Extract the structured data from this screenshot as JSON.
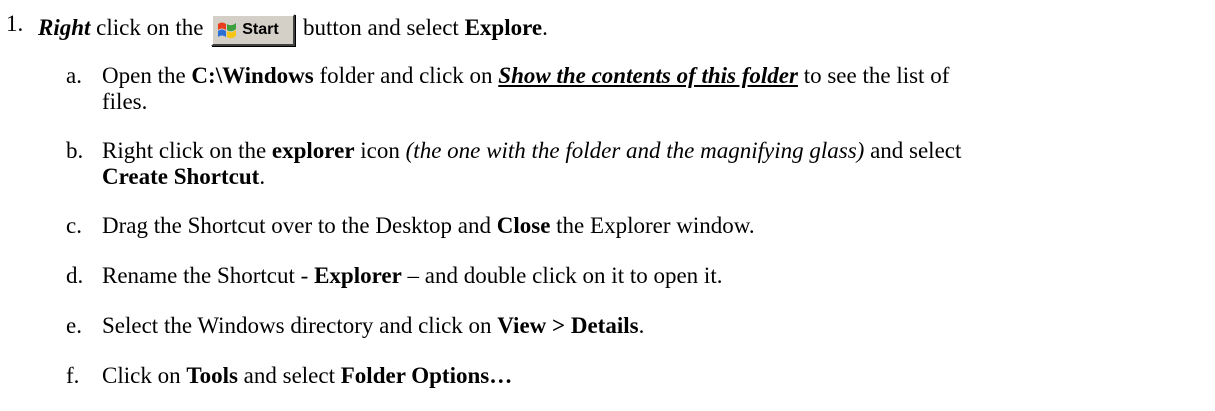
{
  "step1": {
    "number": "1.",
    "right": "Right",
    "t1": " click on the ",
    "start_label": "Start",
    "t2": " button and select ",
    "explore": "Explore",
    "end": "."
  },
  "items": {
    "a": {
      "letter": "a.",
      "t1": "Open the ",
      "b1": "C:\\Windows",
      "t2": " folder and click on ",
      "link": "Show the contents of this folder",
      "t3": " to see the list of",
      "line2": "files."
    },
    "b": {
      "letter": "b.",
      "t1": "Right click on the ",
      "b1": "explorer",
      "t2": " icon ",
      "i1": "(the one with the folder and the magnifying glass)",
      "t3": " and select",
      "b2": "Create Shortcut",
      "end": "."
    },
    "c": {
      "letter": "c.",
      "t1": "Drag the Shortcut over to the Desktop and ",
      "b1": "Close",
      "t2": " the Explorer window."
    },
    "d": {
      "letter": "d.",
      "t1": "Rename the Shortcut - ",
      "b1": "Explorer",
      "t2": " – and double click on it to open it."
    },
    "e": {
      "letter": "e.",
      "t1": "Select the Windows directory and click on ",
      "b1": "View > Details",
      "end": "."
    },
    "f": {
      "letter": "f.",
      "t1": "Click on ",
      "b1": "Tools",
      "t2": " and select ",
      "b2": "Folder Options…"
    }
  },
  "colors": {
    "text": "#000000",
    "button_face": "#d4d0c8"
  },
  "icons": {
    "start_button": "windows-flag-icon"
  }
}
